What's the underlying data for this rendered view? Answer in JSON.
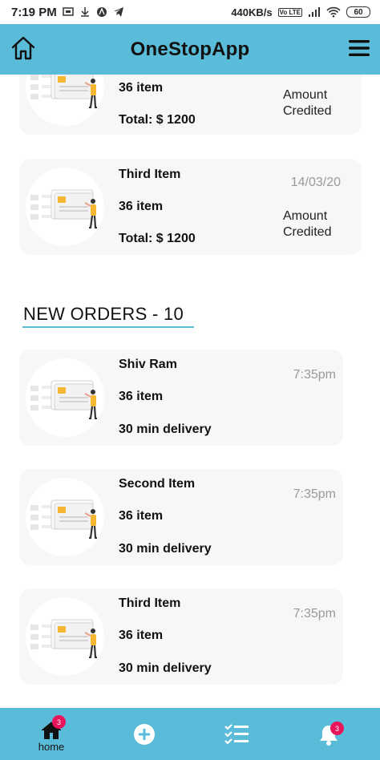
{
  "status_bar": {
    "time": "7:19 PM",
    "speed": "440KB/s",
    "volte": "Vo LTE",
    "battery": "60",
    "icons": [
      "screenshot-icon",
      "download-icon",
      "app-icon",
      "telegram-icon",
      "signal-icon",
      "wifi-icon",
      "battery-icon"
    ]
  },
  "app_bar": {
    "title": "OneStopApp",
    "left_icon": "home-outline-icon",
    "right_icon": "hamburger-menu-icon"
  },
  "completed_orders": [
    {
      "title": "",
      "count": "36  item",
      "total": "Total: $ 1200",
      "date": "",
      "status_line1": "Amount",
      "status_line2": "Credited"
    },
    {
      "title": "Third Item",
      "count": "36  item",
      "total": "Total: $ 1200",
      "date": "14/03/20",
      "status_line1": "Amount",
      "status_line2": "Credited"
    }
  ],
  "new_orders_section": {
    "title": "NEW ORDERS - 10"
  },
  "new_orders": [
    {
      "title": "Shiv Ram",
      "count": "36  item",
      "delivery": "30 min delivery",
      "time": "7:35pm"
    },
    {
      "title": "Second Item",
      "count": "36  item",
      "delivery": "30 min delivery",
      "time": "7:35pm"
    },
    {
      "title": "Third Item",
      "count": "36  item",
      "delivery": "30 min delivery",
      "time": "7:35pm"
    }
  ],
  "bottom_nav": {
    "home_label": "home",
    "home_badge": "3",
    "notification_badge": "3",
    "icons": [
      "home-icon",
      "add-circle-icon",
      "checklist-icon",
      "bell-icon"
    ]
  },
  "colors": {
    "accent": "#5bbcd9",
    "card_bg": "#f7f7f7",
    "badge": "#e8155a",
    "muted_text": "#9a9a9a",
    "illustration_orange": "#f5b731"
  }
}
